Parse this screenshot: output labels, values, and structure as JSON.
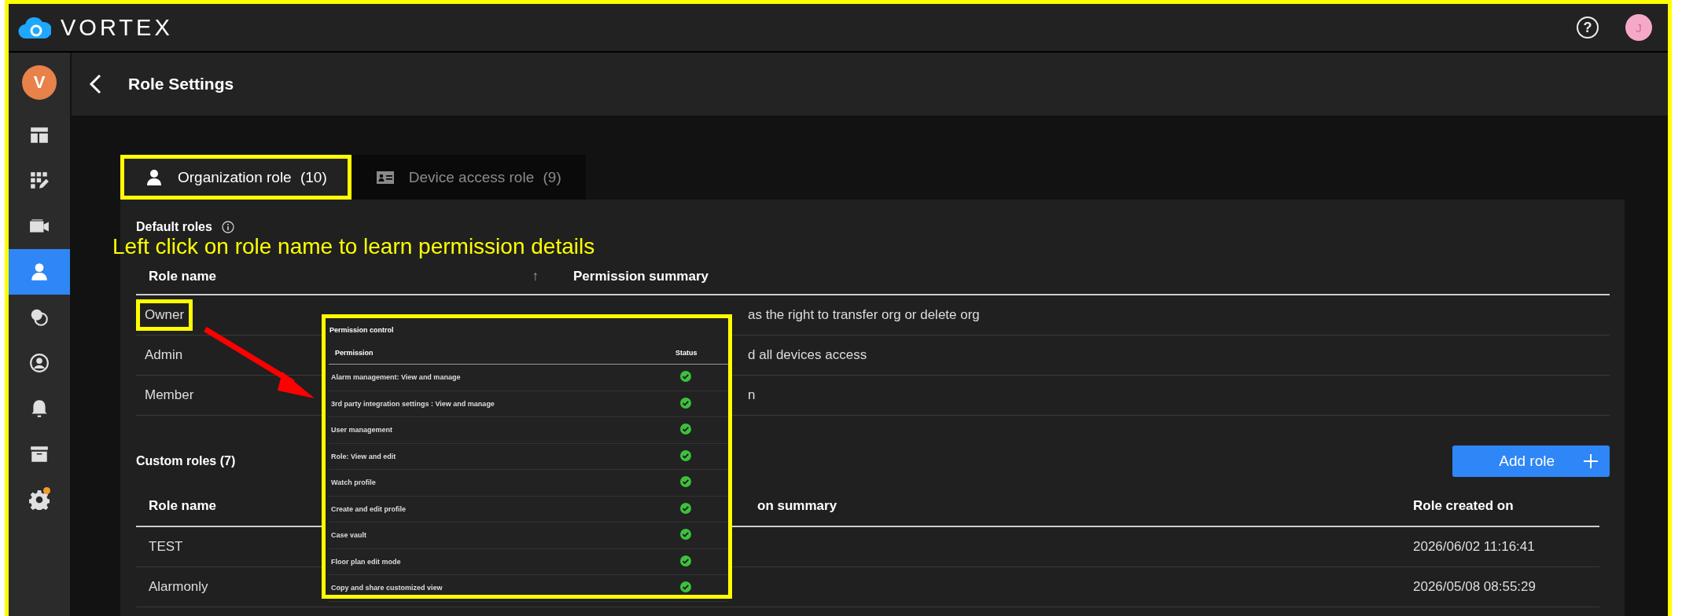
{
  "header": {
    "logo": "VORTEX",
    "help": "?",
    "avatar": "J"
  },
  "sidebar": {
    "avatar": "V",
    "items": [
      {
        "kind": "layout",
        "selected": false,
        "badge": false
      },
      {
        "kind": "grid-edit",
        "selected": false,
        "badge": false
      },
      {
        "kind": "camera",
        "selected": false,
        "badge": false
      },
      {
        "kind": "person",
        "selected": true,
        "badge": false
      },
      {
        "kind": "circles",
        "selected": false,
        "badge": false
      },
      {
        "kind": "user-circle",
        "selected": false,
        "badge": false
      },
      {
        "kind": "bell",
        "selected": false,
        "badge": false
      },
      {
        "kind": "archive",
        "selected": false,
        "badge": false
      },
      {
        "kind": "gear",
        "selected": false,
        "badge": true
      }
    ]
  },
  "page": {
    "title": "Role Settings"
  },
  "tabs": [
    {
      "kind": "person",
      "label": "Organization role",
      "count": "(10)",
      "selected": true,
      "highlighted": true
    },
    {
      "kind": "id-card",
      "label": "Device access role",
      "count": "(9)",
      "selected": false,
      "highlighted": false
    }
  ],
  "default_roles": {
    "title": "Default roles",
    "columns": [
      {
        "label": "Role name",
        "sort": "↑"
      },
      {
        "label": "Permission summary"
      }
    ],
    "rows": [
      {
        "name": "Owner",
        "summary": "as the right to transfer org or delete org",
        "highlighted": true
      },
      {
        "name": "Admin",
        "summary": "d all devices access",
        "highlighted": false
      },
      {
        "name": "Member",
        "summary": "n",
        "highlighted": false
      }
    ]
  },
  "custom_roles": {
    "title": "Custom roles (7)",
    "add_button": "Add role",
    "columns": [
      "Role name",
      "on summary",
      "Role created on"
    ],
    "rows": [
      {
        "name": "TEST",
        "created": "2026/06/02 11:16:41"
      },
      {
        "name": "Alarmonly",
        "created": "2026/05/08 08:55:29"
      }
    ]
  },
  "annotation": {
    "note": "Left click on role name to learn permission details",
    "callout": {
      "title": "Permission control",
      "columns": [
        "Permission",
        "Status"
      ],
      "rows": [
        {
          "permission": "Alarm management: View and manage",
          "granted": true
        },
        {
          "permission": "3rd party integration settings : View and manage",
          "granted": true
        },
        {
          "permission": "User management",
          "granted": true
        },
        {
          "permission": "Role: View and edit",
          "granted": true
        },
        {
          "permission": "Watch profile",
          "granted": true
        },
        {
          "permission": "Create and edit profile",
          "granted": true
        },
        {
          "permission": "Case vault",
          "granted": true
        },
        {
          "permission": "Floor plan edit mode",
          "granted": true
        },
        {
          "permission": "Copy and share customized view",
          "granted": true
        }
      ]
    }
  }
}
